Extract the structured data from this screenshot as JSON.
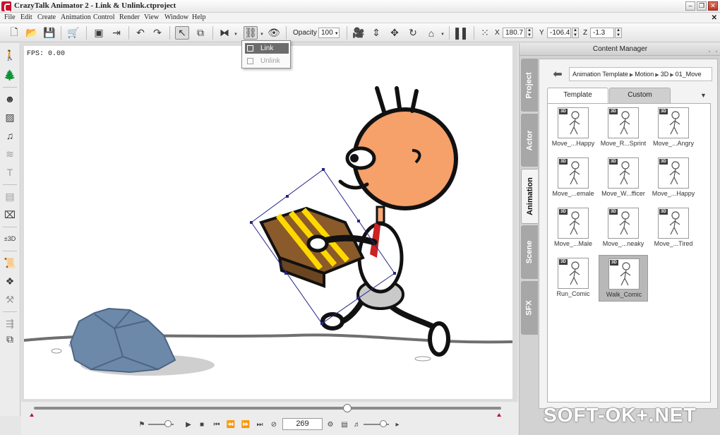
{
  "window": {
    "title": "CrazyTalk Animator 2   - Link & Unlink.ctproject"
  },
  "menu": [
    "File",
    "Edit",
    "Create",
    "Animation",
    "Control",
    "Render",
    "View",
    "Window",
    "Help"
  ],
  "toolbar": {
    "opacity_label": "Opacity :",
    "opacity_value": "100",
    "x_label": "X",
    "x_value": "180.7",
    "y_label": "Y",
    "y_value": "-106.4",
    "z_label": "Z",
    "z_value": "-1.3"
  },
  "link_menu": {
    "link": "Link",
    "unlink": "Unlink"
  },
  "canvas": {
    "fps": "FPS: 0.00"
  },
  "timeline": {
    "frame": "269",
    "progress": 0.67
  },
  "content_manager": {
    "title": "Content Manager",
    "side_tabs": [
      "Project",
      "Actor",
      "Animation",
      "Scene",
      "SFX"
    ],
    "breadcrumb": [
      "Animation Template",
      "Motion",
      "3D",
      "01_Move"
    ],
    "tabs": [
      "Template",
      "Custom"
    ],
    "items": [
      {
        "label": "Move_...Happy"
      },
      {
        "label": "Move_R...Sprint"
      },
      {
        "label": "Move_...Angry"
      },
      {
        "label": "Move_...emale"
      },
      {
        "label": "Move_W...fficer"
      },
      {
        "label": "Move_...Happy"
      },
      {
        "label": "Move_...Male"
      },
      {
        "label": "Move_...neaky"
      },
      {
        "label": "Move_...Tired"
      },
      {
        "label": "Run_Comic"
      },
      {
        "label": "Walk_Comic"
      }
    ],
    "badge": "3D"
  },
  "watermark": "SOFT-OK+.NET"
}
